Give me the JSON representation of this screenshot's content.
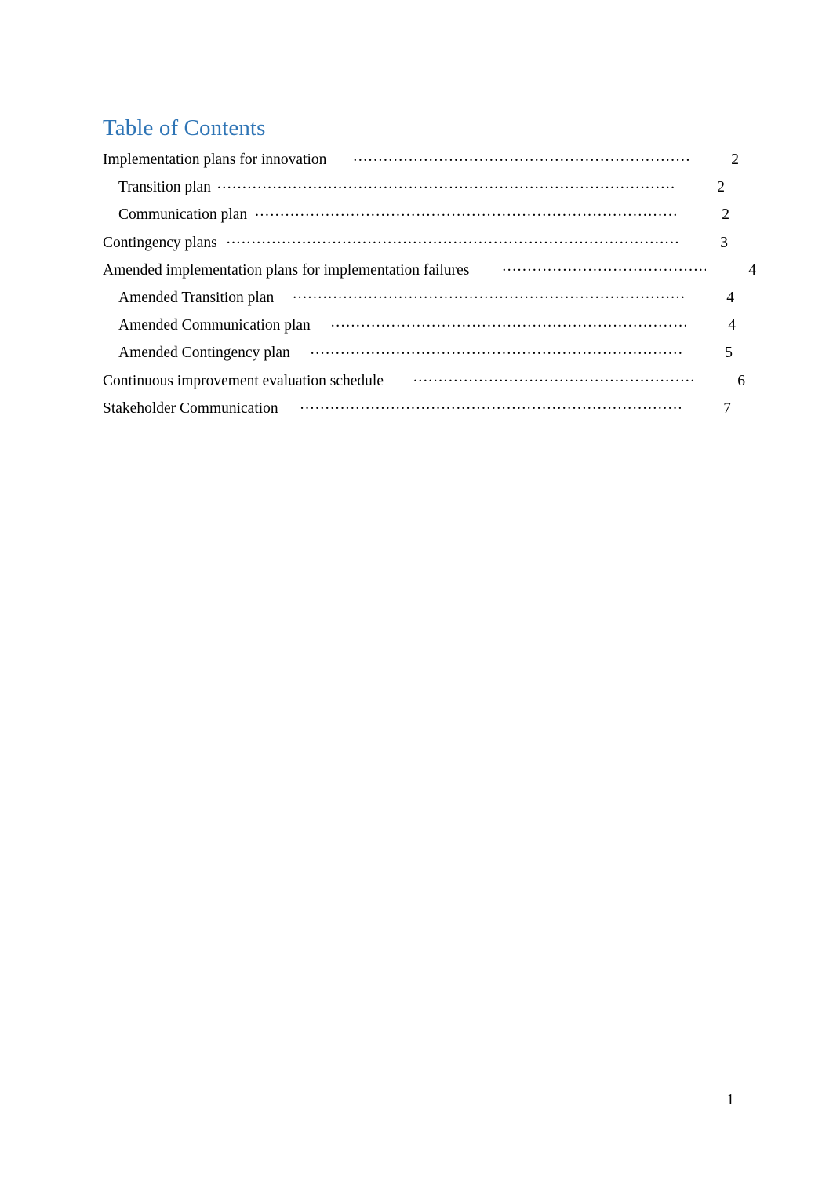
{
  "document": {
    "heading": "Table of Contents",
    "heading_color": "#2E74B5",
    "footer_page_number": "1"
  },
  "toc": {
    "entries": [
      {
        "label": "Implementation plans for innovation",
        "page": "2",
        "level": 1,
        "gap": 34,
        "leader_end": 878
      },
      {
        "label": "Transition plan",
        "page": "2",
        "level": 2,
        "gap": 8,
        "leader_end": 860
      },
      {
        "label": "Communication plan",
        "page": "2",
        "level": 2,
        "gap": 10,
        "leader_end": 866
      },
      {
        "label": "Contingency plans",
        "page": "3",
        "level": 1,
        "gap": 12,
        "leader_end": 864
      },
      {
        "label": "Amended implementation plans for implementation failures",
        "page": "4",
        "level": 1,
        "gap": 42,
        "leader_end": 900
      },
      {
        "label": "Amended Transition plan",
        "page": "4",
        "level": 2,
        "gap": 24,
        "leader_end": 872
      },
      {
        "label": "Amended Communication plan",
        "page": "4",
        "level": 2,
        "gap": 26,
        "leader_end": 874
      },
      {
        "label": "Amended Contingency plan",
        "page": "5",
        "level": 2,
        "gap": 26,
        "leader_end": 870
      },
      {
        "label": "Continuous improvement evaluation schedule",
        "page": "6",
        "level": 1,
        "gap": 38,
        "leader_end": 886
      },
      {
        "label": "Stakeholder Communication",
        "page": "7",
        "level": 1,
        "gap": 28,
        "leader_end": 868
      }
    ]
  }
}
